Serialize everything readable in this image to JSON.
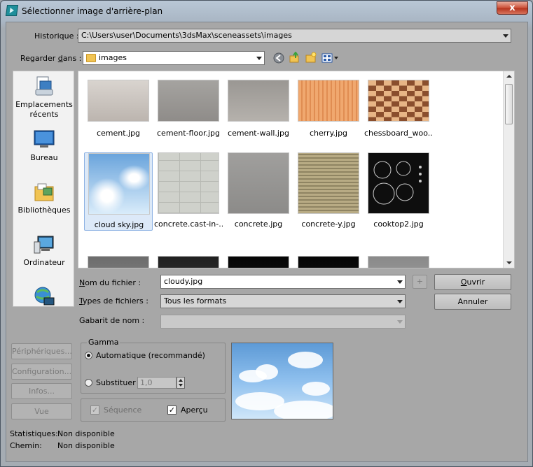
{
  "window": {
    "title": "Sélectionner image d'arrière-plan",
    "close_label": "x"
  },
  "history": {
    "label": "Historique :",
    "value": "C:\\Users\\user\\Documents\\3dsMax\\sceneassets\\images"
  },
  "look_in": {
    "label_pre": "Regarder ",
    "label_u": "d",
    "label_post": "ans :",
    "value": "images"
  },
  "toolbar": {
    "icons": [
      "back-icon",
      "up-folder-icon",
      "new-folder-icon",
      "view-menu-icon"
    ]
  },
  "places": [
    {
      "label": "Emplacements récents",
      "icon": "recent-places-icon"
    },
    {
      "label": "Bureau",
      "icon": "desktop-icon"
    },
    {
      "label": "Bibliothèques",
      "icon": "libraries-icon"
    },
    {
      "label": "Ordinateur",
      "icon": "computer-icon"
    },
    {
      "label": "",
      "icon": "network-icon"
    }
  ],
  "files": [
    {
      "name": "cement.jpg",
      "colors": [
        "#d9d4cf",
        "#bcb5af"
      ]
    },
    {
      "name": "cement-floor.jpg",
      "colors": [
        "#a5a3a0",
        "#8f8c89"
      ]
    },
    {
      "name": "cement-wall.jpg",
      "colors": [
        "#9a9793",
        "#b5b1ac"
      ]
    },
    {
      "name": "cherry.jpg",
      "colors": [
        "#f0a86f",
        "#e08d52"
      ]
    },
    {
      "name": "chessboard_woo...",
      "colors": [
        "#8a4e2d",
        "#e7b586"
      ]
    },
    {
      "name": "cloud sky.jpg",
      "colors": [
        "#6aa4dc",
        "#d9ecfa"
      ],
      "selected": true
    },
    {
      "name": "concrete.cast-in-...",
      "colors": [
        "#cfd1cb",
        "#b7b9b3"
      ]
    },
    {
      "name": "concrete.jpg",
      "colors": [
        "#a09f9d",
        "#8c8b89"
      ]
    },
    {
      "name": "concrete-y.jpg",
      "colors": [
        "#b8ab84",
        "#8f8462"
      ]
    },
    {
      "name": "cooktop2.jpg",
      "colors": [
        "#0e0e0e",
        "#1c1c1c"
      ]
    },
    {
      "name": "",
      "colors": [
        "#6c6c6c",
        "#888"
      ]
    },
    {
      "name": "",
      "colors": [
        "#202020",
        "#333"
      ]
    },
    {
      "name": "",
      "colors": [
        "#050505",
        "#111"
      ]
    },
    {
      "name": "",
      "colors": [
        "#050505",
        "#111"
      ]
    },
    {
      "name": "",
      "colors": [
        "#8a8a8a",
        "#a0a0a0"
      ]
    }
  ],
  "filename": {
    "label_u": "N",
    "label_post": "om du fichier :",
    "value": "cloudy.jpg"
  },
  "filetype": {
    "label_u": "T",
    "label_post": "ypes de fichiers :",
    "value": "Tous les formats"
  },
  "gabarit": {
    "label": "Gabarit de nom :",
    "value": ""
  },
  "plus_label": "+",
  "open_button": {
    "label_u": "O",
    "label_post": "uvrir"
  },
  "cancel_button": {
    "label": "Annuler"
  },
  "side_buttons": [
    "Périphériques...",
    "Configuration...",
    "Infos...",
    "Vue"
  ],
  "gamma": {
    "title": "Gamma",
    "auto_label": "Automatique (recommandé)",
    "subst_label": "Substituer",
    "subst_value": "1,0"
  },
  "sequence_label": "Séquence",
  "apercu_label": "Aperçu",
  "status": {
    "stats_label": "Statistiques:",
    "stats_value": "Non disponible",
    "path_label": "Chemin:",
    "path_value": "Non disponible"
  }
}
